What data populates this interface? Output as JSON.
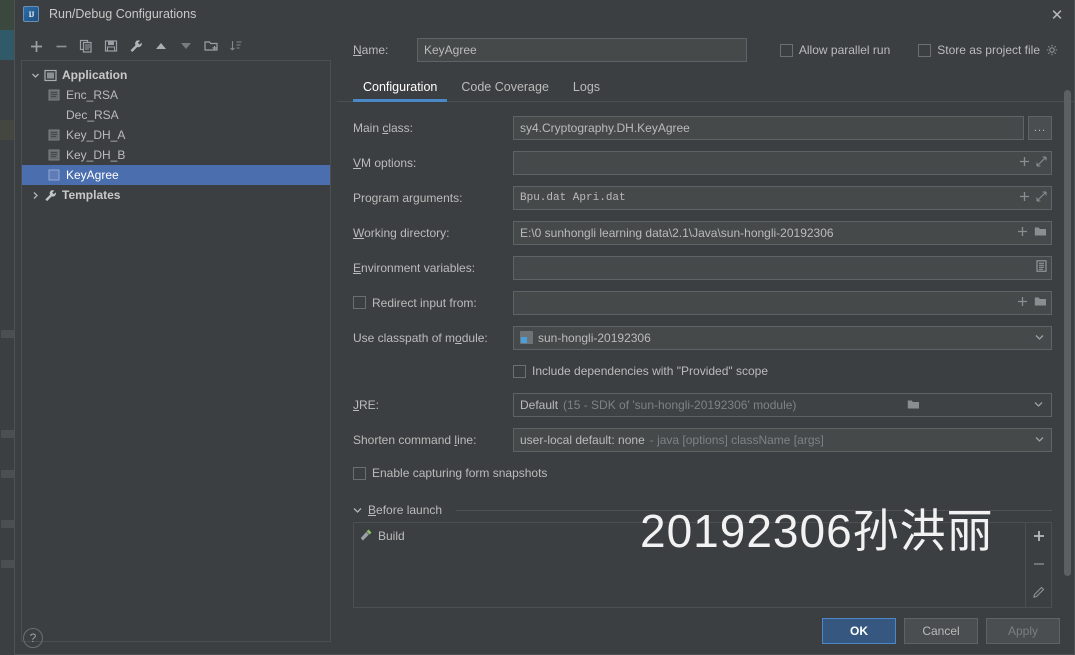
{
  "window": {
    "title": "Run/Debug Configurations",
    "logo_icon": "intellij-idea-logo",
    "close_icon": "close-icon",
    "close_label": "✕"
  },
  "toolbar": {
    "buttons": [
      {
        "name": "add-configuration-button",
        "icon": "plus-icon",
        "glyph": "+"
      },
      {
        "name": "remove-configuration-button",
        "icon": "minus-icon",
        "glyph": "−"
      },
      {
        "name": "copy-configuration-button",
        "icon": "copy-icon",
        "glyph": "⧉"
      },
      {
        "name": "save-configuration-button",
        "icon": "save-icon",
        "glyph": "▤"
      },
      {
        "name": "edit-templates-button",
        "icon": "wrench-icon",
        "glyph": "🔧"
      },
      {
        "name": "move-up-button",
        "icon": "arrow-up-icon",
        "glyph": "▲"
      },
      {
        "name": "move-down-button",
        "icon": "arrow-down-icon",
        "glyph": "▼"
      },
      {
        "name": "new-folder-button",
        "icon": "folder-add-icon",
        "glyph": "📁"
      },
      {
        "name": "sort-configurations-button",
        "icon": "sort-icon",
        "glyph": "⇅"
      }
    ]
  },
  "tree": {
    "nodes": [
      {
        "label": "Application",
        "icon": "application-icon",
        "expanded": true,
        "bold": true,
        "level": 0,
        "selected": false,
        "twisty": "⌄"
      },
      {
        "label": "Enc_RSA",
        "icon": "run-config-icon",
        "expanded": null,
        "bold": false,
        "level": 1,
        "selected": false,
        "twisty": ""
      },
      {
        "label": "Dec_RSA",
        "icon": "",
        "expanded": null,
        "bold": false,
        "level": 1,
        "selected": false,
        "twisty": ""
      },
      {
        "label": "Key_DH_A",
        "icon": "run-config-icon",
        "expanded": null,
        "bold": false,
        "level": 1,
        "selected": false,
        "twisty": ""
      },
      {
        "label": "Key_DH_B",
        "icon": "run-config-icon",
        "expanded": null,
        "bold": false,
        "level": 1,
        "selected": false,
        "twisty": ""
      },
      {
        "label": "KeyAgree",
        "icon": "run-config-icon",
        "expanded": null,
        "bold": false,
        "level": 1,
        "selected": true,
        "twisty": ""
      },
      {
        "label": "Templates",
        "icon": "wrench-icon",
        "expanded": false,
        "bold": true,
        "level": 0,
        "selected": false,
        "twisty": "›"
      }
    ]
  },
  "help": {
    "label": "?",
    "icon": "help-icon"
  },
  "name_row": {
    "label": "Name:",
    "value": "KeyAgree",
    "allow_parallel_run": {
      "label": "Allow parallel run",
      "checked": false
    },
    "store_as_project_file": {
      "label": "Store as project file",
      "checked": false
    },
    "gear_icon": "gear-icon"
  },
  "tabs": [
    {
      "label": "Configuration",
      "active": true
    },
    {
      "label": "Code Coverage",
      "active": false
    },
    {
      "label": "Logs",
      "active": false
    }
  ],
  "form": {
    "main_class": {
      "label": "Main class:",
      "value": "sy4.Cryptography.DH.KeyAgree",
      "browse_label": "..."
    },
    "vm_options": {
      "label": "VM options:",
      "value": "",
      "icons": [
        "macro-plus-icon",
        "expand-icon"
      ]
    },
    "program_arguments": {
      "label": "Program arguments:",
      "value": "Bpu.dat Apri.dat",
      "icons": [
        "macro-plus-icon",
        "expand-icon"
      ]
    },
    "working_directory": {
      "label": "Working directory:",
      "value": "E:\\0 sunhongli learning data\\2.1\\Java\\sun-hongli-20192306",
      "icons": [
        "macro-plus-icon",
        "folder-icon"
      ]
    },
    "environment_variables": {
      "label": "Environment variables:",
      "value": "",
      "icons": [
        "env-list-icon"
      ]
    },
    "redirect_input_from": {
      "label": "Redirect input from:",
      "checked": false,
      "value": "",
      "icons": [
        "macro-plus-icon",
        "folder-icon"
      ]
    },
    "use_classpath_of_module": {
      "label": "Use classpath of module:",
      "value": "sun-hongli-20192306",
      "module_icon": "module-icon",
      "caret": "▾"
    },
    "include_provided": {
      "label": "Include dependencies with \"Provided\" scope",
      "checked": false
    },
    "jre": {
      "label": "JRE:",
      "value": "Default",
      "hint": "(15 - SDK of 'sun-hongli-20192306' module)",
      "folder_icon": "folder-icon",
      "caret": "▾"
    },
    "shorten_command_line": {
      "label": "Shorten command line:",
      "value": "user-local default: none",
      "hint": "- java [options] className [args]",
      "caret": "▾"
    },
    "enable_form_snapshots": {
      "label": "Enable capturing form snapshots",
      "checked": false
    }
  },
  "before_launch": {
    "title": "Before launch",
    "twisty": "▾",
    "items": [
      {
        "label": "Build",
        "icon": "build-hammer-icon"
      }
    ],
    "side_buttons": [
      {
        "name": "add-before-launch-task-button",
        "icon": "plus-icon",
        "glyph": "+"
      },
      {
        "name": "remove-before-launch-task-button",
        "icon": "minus-icon",
        "glyph": "−"
      },
      {
        "name": "edit-before-launch-task-button",
        "icon": "pencil-icon",
        "glyph": "✎"
      }
    ]
  },
  "footer": {
    "ok": "OK",
    "cancel": "Cancel",
    "apply": "Apply"
  },
  "watermark": {
    "text": "20192306孙洪丽"
  },
  "colors": {
    "dialog_bg": "#3c3f41",
    "field_bg": "#45494a",
    "selection_blue": "#4b6eaf",
    "accent_blue": "#4a88c7",
    "primary_button": "#365880",
    "text": "#bbbbbb",
    "dim_text": "#7d8285"
  }
}
